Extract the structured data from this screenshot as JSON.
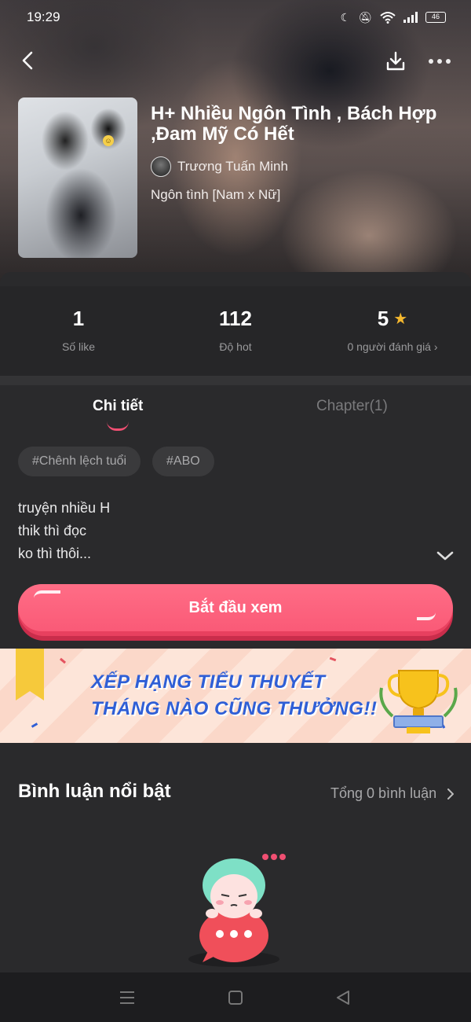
{
  "status_bar": {
    "time": "19:29",
    "battery": "46"
  },
  "book": {
    "title": "H+ Nhiều Ngôn Tình , Bách Hợp ,Đam Mỹ Có Hết",
    "author": "Trương Tuấn Minh",
    "genre": "Ngôn tình [Nam x Nữ]"
  },
  "stats": [
    {
      "value": "1",
      "label": "Số like"
    },
    {
      "value": "112",
      "label": "Độ hot"
    },
    {
      "value": "5",
      "label": "0 người đánh giá"
    }
  ],
  "tabs": [
    {
      "label": "Chi tiết",
      "active": true
    },
    {
      "label": "Chapter(1)",
      "active": false
    }
  ],
  "tags": [
    "#Chênh lệch tuổi",
    "#ABO"
  ],
  "description": [
    "truyện nhiều H",
    "thik thì đọc",
    "ko thì thôi..."
  ],
  "start_button": "Bắt đầu xem",
  "banner": {
    "line1": "XẾP HẠNG TIỂU THUYẾT",
    "line2": "THÁNG NÀO CŨNG THƯỞNG!!"
  },
  "comments": {
    "title": "Bình luận nổi bật",
    "count_label": "Tổng 0 bình luận"
  },
  "colors": {
    "accent": "#fa5a77",
    "star": "#f5b82e",
    "banner_text": "#2f5fd6"
  }
}
